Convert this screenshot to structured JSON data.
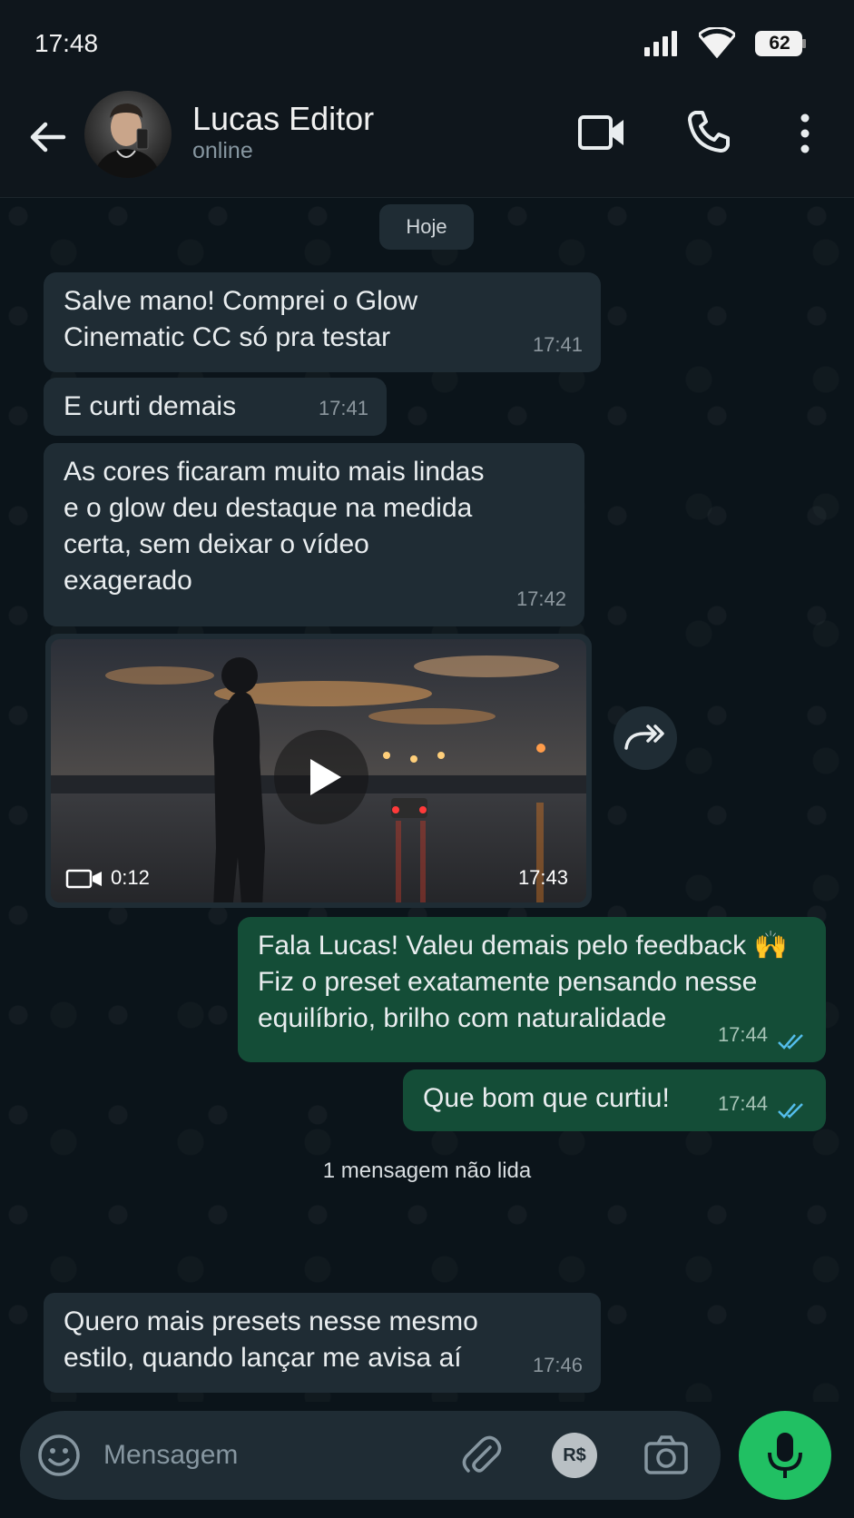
{
  "status_bar": {
    "time": "17:48",
    "battery": "62"
  },
  "header": {
    "contact_name": "Lucas Editor",
    "contact_status": "online"
  },
  "chat": {
    "date_label": "Hoje",
    "messages": [
      {
        "direction": "in",
        "text": "Salve mano! Comprei o Glow\nCinematic CC só pra testar",
        "time": "17:41"
      },
      {
        "direction": "in",
        "text": "E curti demais",
        "time": "17:41"
      },
      {
        "direction": "in",
        "text": "As cores ficaram muito mais lindas\ne o glow deu destaque na medida\ncerta, sem deixar o vídeo\nexagerado",
        "time": "17:42"
      },
      {
        "direction": "out",
        "text": "Fala Lucas! Valeu demais pelo feedback 🙌\nFiz o preset exatamente pensando nesse\nequilíbrio, brilho com naturalidade",
        "time": "17:44",
        "status": "read"
      },
      {
        "direction": "out",
        "text": "Que bom que curtiu!",
        "time": "17:44",
        "status": "read"
      },
      {
        "direction": "in",
        "text": "Quero mais presets nesse mesmo\nestilo, quando lançar me avisa aí",
        "time": "17:46"
      }
    ],
    "video_message": {
      "duration": "0:12",
      "time": "17:43"
    },
    "unread_label": "1 mensagem não lida"
  },
  "input_bar": {
    "placeholder": "Mensagem",
    "payment_label": "R$"
  },
  "colors": {
    "incoming_bubble": "#1f2c34",
    "outgoing_bubble": "#144d37",
    "read_ticks": "#53bdeb",
    "mic_button": "#21c063"
  }
}
